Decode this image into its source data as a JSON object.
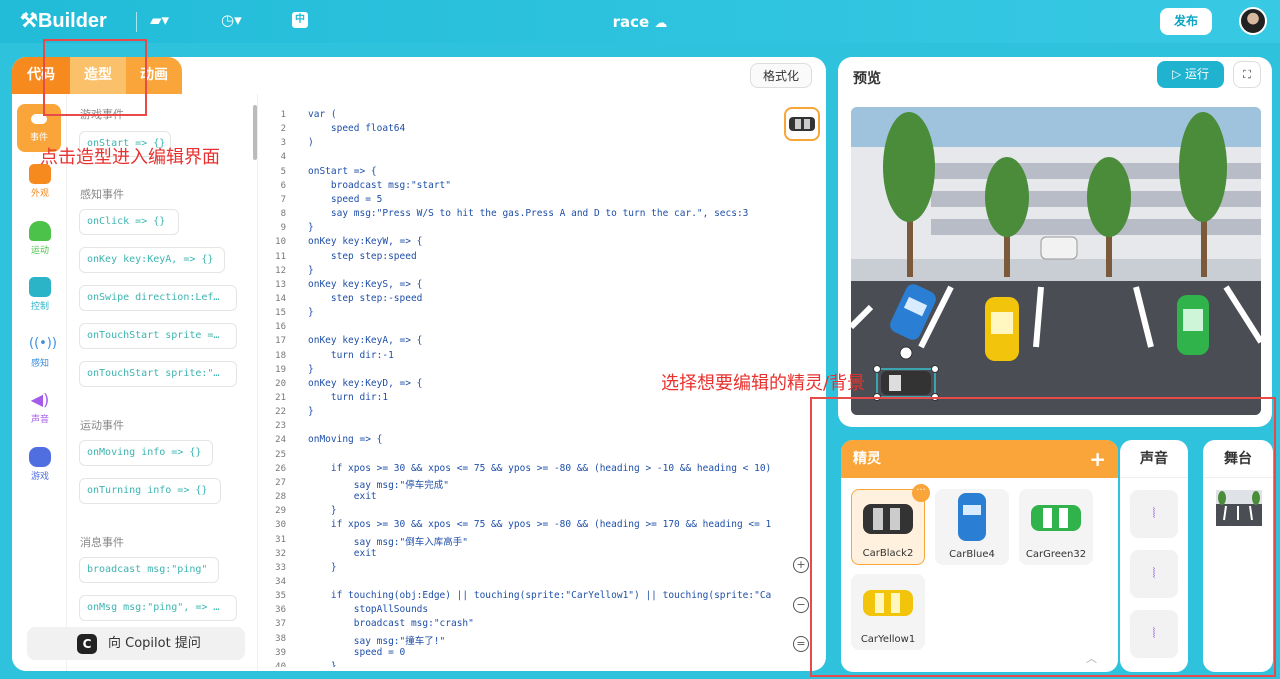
{
  "topbar": {
    "logo": "Builder",
    "title": "race",
    "publish": "发布"
  },
  "tabs": {
    "code": "代码",
    "costume": "造型",
    "animation": "动画"
  },
  "format_button": "格式化",
  "categories": [
    {
      "label": "事件",
      "color": "#f9a53a"
    },
    {
      "label": "外观",
      "color": "#f68a1e"
    },
    {
      "label": "运动",
      "color": "#4cc24a"
    },
    {
      "label": "控制",
      "color": "#2bb3c8"
    },
    {
      "label": "感知",
      "color": "#3b8fe0"
    },
    {
      "label": "声音",
      "color": "#a35be8"
    },
    {
      "label": "游戏",
      "color": "#4f6fe0"
    }
  ],
  "palette": {
    "game_events": "游戏事件",
    "block_onstart": "onStart => {}",
    "sense_events": "感知事件",
    "block_onclick": "onClick => {}",
    "block_onkey": "onKey key:KeyA, => {}",
    "block_onswipe": "onSwipe direction:Lef…",
    "block_ontouchstart1": "onTouchStart sprite =…",
    "block_ontouchstart2": "onTouchStart sprite:\"…",
    "motion_events": "运动事件",
    "block_onmoving": "onMoving info => {}",
    "block_onturning": "onTurning info => {}",
    "message_events": "消息事件",
    "block_broadcast": "broadcast msg:\"ping\"",
    "block_onmsg": "onMsg msg:\"ping\", => …"
  },
  "copilot": "向 Copilot 提问",
  "code_lines": [
    {
      "n": "1",
      "t": "var ("
    },
    {
      "n": "2",
      "t": "    speed float64"
    },
    {
      "n": "3",
      "t": ")"
    },
    {
      "n": "4",
      "t": ""
    },
    {
      "n": "5",
      "t": "onStart => {"
    },
    {
      "n": "6",
      "t": "    broadcast msg:\"start\""
    },
    {
      "n": "7",
      "t": "    speed = 5"
    },
    {
      "n": "8",
      "t": "    say msg:\"Press W/S to hit the gas.Press A and D to turn the car.\", secs:3"
    },
    {
      "n": "9",
      "t": "}"
    },
    {
      "n": "10",
      "t": "onKey key:KeyW, => {"
    },
    {
      "n": "11",
      "t": "    step step:speed"
    },
    {
      "n": "12",
      "t": "}"
    },
    {
      "n": "13",
      "t": "onKey key:KeyS, => {"
    },
    {
      "n": "14",
      "t": "    step step:-speed"
    },
    {
      "n": "15",
      "t": "}"
    },
    {
      "n": "16",
      "t": ""
    },
    {
      "n": "17",
      "t": "onKey key:KeyA, => {"
    },
    {
      "n": "18",
      "t": "    turn dir:-1"
    },
    {
      "n": "19",
      "t": "}"
    },
    {
      "n": "20",
      "t": "onKey key:KeyD, => {"
    },
    {
      "n": "21",
      "t": "    turn dir:1"
    },
    {
      "n": "22",
      "t": "}"
    },
    {
      "n": "23",
      "t": ""
    },
    {
      "n": "24",
      "t": "onMoving => {"
    },
    {
      "n": "25",
      "t": ""
    },
    {
      "n": "26",
      "t": "    if xpos >= 30 && xpos <= 75 && ypos >= -80 && (heading > -10 && heading < 10)"
    },
    {
      "n": "27",
      "t": "        say msg:\"停车完成\""
    },
    {
      "n": "28",
      "t": "        exit"
    },
    {
      "n": "29",
      "t": "    }"
    },
    {
      "n": "30",
      "t": "    if xpos >= 30 && xpos <= 75 && ypos >= -80 && (heading >= 170 && heading <= 1"
    },
    {
      "n": "31",
      "t": "        say msg:\"倒车入库高手\""
    },
    {
      "n": "32",
      "t": "        exit"
    },
    {
      "n": "33",
      "t": "    }"
    },
    {
      "n": "34",
      "t": ""
    },
    {
      "n": "35",
      "t": "    if touching(obj:Edge) || touching(sprite:\"CarYellow1\") || touching(sprite:\"Ca"
    },
    {
      "n": "36",
      "t": "        stopAllSounds"
    },
    {
      "n": "37",
      "t": "        broadcast msg:\"crash\""
    },
    {
      "n": "38",
      "t": "        say msg:\"撞车了!\""
    },
    {
      "n": "39",
      "t": "        speed = 0"
    },
    {
      "n": "40",
      "t": "    }"
    }
  ],
  "preview": {
    "title": "预览",
    "run": "运行"
  },
  "sprites_panel": {
    "title": "精灵",
    "sprites": [
      {
        "name": "CarBlack2",
        "color": "#333333"
      },
      {
        "name": "CarBlue4",
        "color": "#2a7fd4"
      },
      {
        "name": "CarGreen32",
        "color": "#2fb34a"
      },
      {
        "name": "CarYellow1",
        "color": "#f2c40c"
      }
    ]
  },
  "sounds_panel": {
    "title": "声音"
  },
  "stage_panel": {
    "title": "舞台"
  },
  "annotations": {
    "costume_hint": "点击造型进入编辑界面",
    "sprite_hint": "选择想要编辑的精灵/背景"
  }
}
